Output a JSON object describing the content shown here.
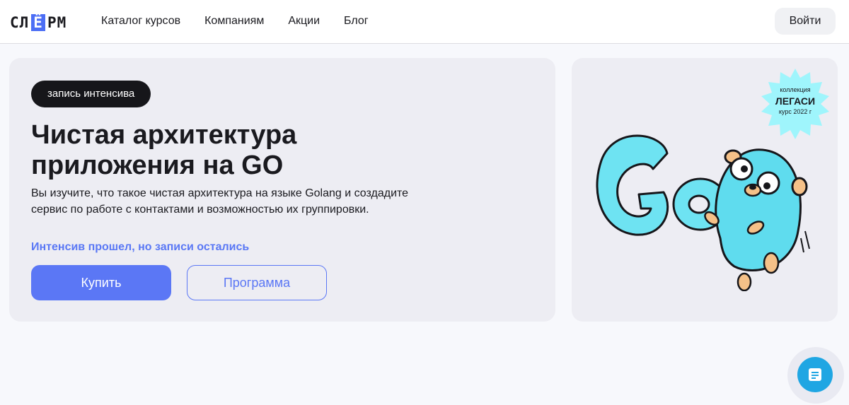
{
  "header": {
    "logo": {
      "pre": "СЛ",
      "highlight": "Ё",
      "post": "РМ"
    },
    "nav": [
      {
        "label": "Каталог курсов"
      },
      {
        "label": "Компаниям"
      },
      {
        "label": "Акции"
      },
      {
        "label": "Блог"
      }
    ],
    "login_label": "Войти"
  },
  "hero": {
    "tag": "запись интенсива",
    "title": "Чистая архитектура приложения на GO",
    "description": "Вы изучите, что такое чистая архитектура на языке Golang и создадите сервис по работе с контактами и возможностью их группировки.",
    "status": "Интенсив прошел, но записи остались",
    "buy_label": "Купить",
    "program_label": "Программа"
  },
  "promo": {
    "badge_line1": "коллекция",
    "badge_line2": "ЛЕГАСИ",
    "badge_line3": "курс 2022 г",
    "illustration": "go-gopher-logo",
    "illustration_text": "Go"
  },
  "chat": {
    "icon": "chat-icon"
  },
  "colors": {
    "accent": "#5b77f5",
    "tag_bg": "#16161a",
    "badge_bg": "#9ff5fc",
    "gopher": "#5fdcee",
    "chat": "#1fa6e3"
  }
}
